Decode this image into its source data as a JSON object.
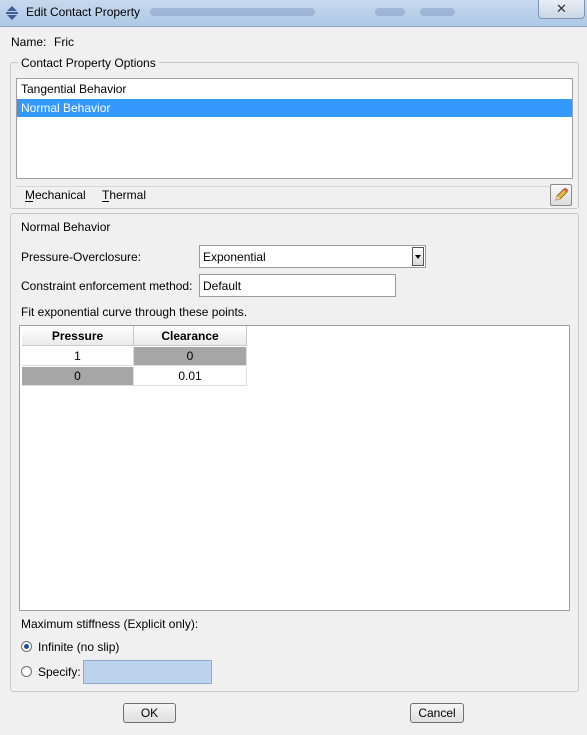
{
  "window": {
    "title": "Edit Contact Property",
    "close_symbol": "✕"
  },
  "name_row": {
    "label": "Name:",
    "value": "Fric"
  },
  "options": {
    "group_title": "Contact Property Options",
    "items": [
      "Tangential Behavior",
      "Normal Behavior"
    ],
    "selected_index": 1
  },
  "menu": {
    "mechanical": "Mechanical",
    "thermal": "Thermal"
  },
  "normal": {
    "group_title": "Normal Behavior",
    "pressure_overclosure_label": "Pressure-Overclosure:",
    "pressure_overclosure_value": "Exponential",
    "constraint_label": "Constraint enforcement method:",
    "constraint_value": "Default",
    "fit_text": "Fit exponential curve through these points."
  },
  "table": {
    "columns": [
      "Pressure",
      "Clearance"
    ],
    "rows": [
      [
        "1",
        "0"
      ],
      [
        "0",
        "0.01"
      ]
    ]
  },
  "stiffness": {
    "label": "Maximum stiffness (Explicit only):",
    "infinite_label": "Infinite (no slip)",
    "specify_label": "Specify:",
    "selected": "infinite"
  },
  "buttons": {
    "ok": "OK",
    "cancel": "Cancel"
  }
}
